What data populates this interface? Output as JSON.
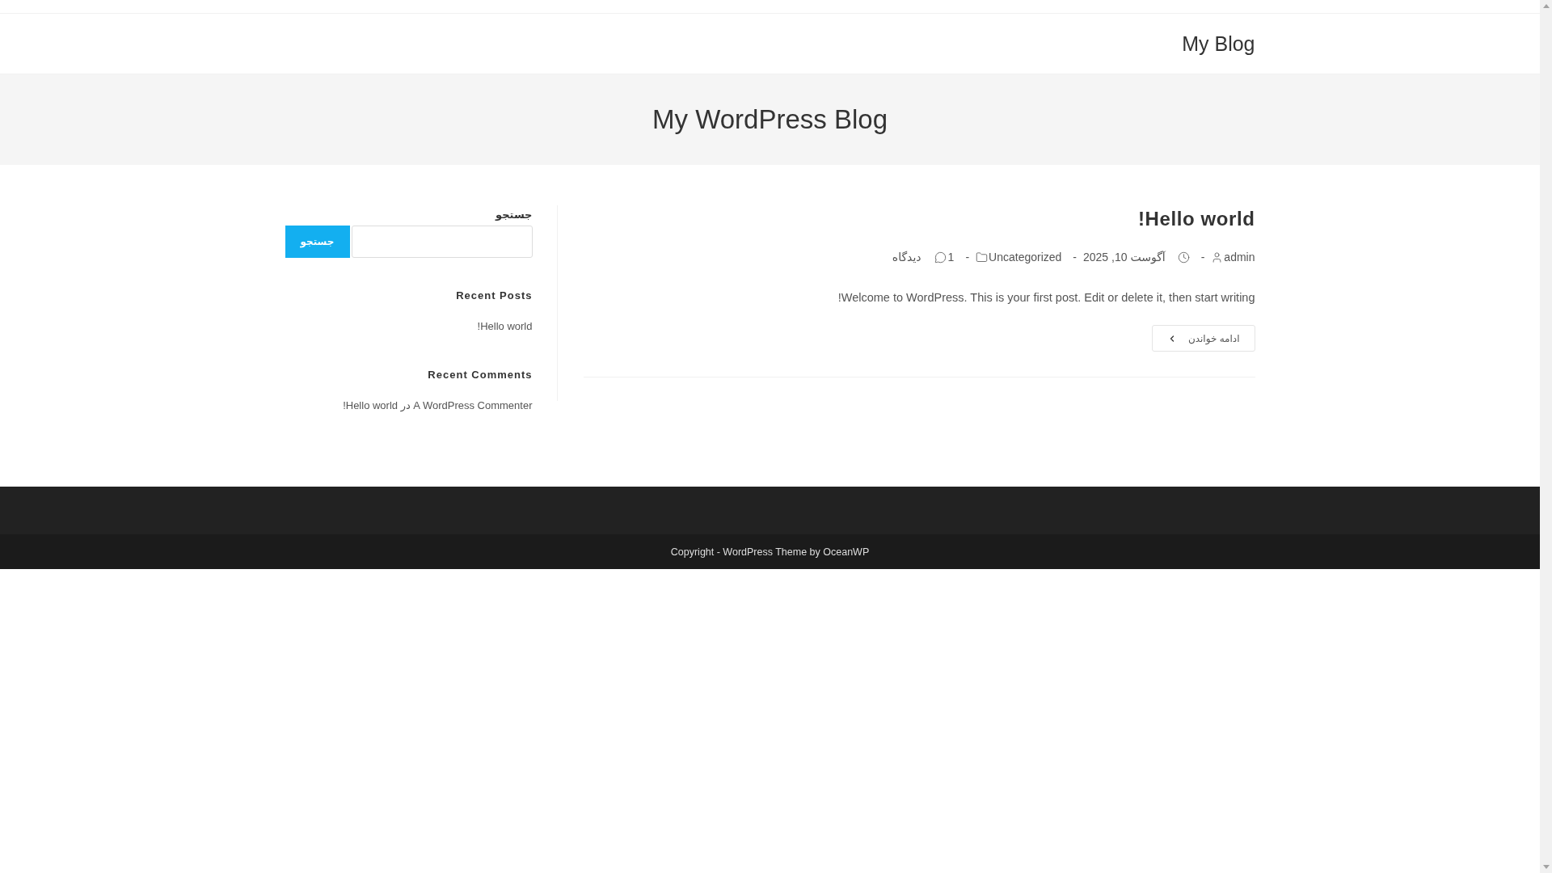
{
  "header": {
    "site_title": "My Blog"
  },
  "page_header": {
    "title": "My WordPress Blog"
  },
  "post": {
    "title": "Hello world!",
    "meta": [
      {
        "kind": "author",
        "text": "admin"
      },
      {
        "kind": "separator",
        "text": "-"
      },
      {
        "kind": "date",
        "text": "آگوست 10, 2025"
      },
      {
        "kind": "separator",
        "text": "-"
      },
      {
        "kind": "category",
        "text": "Uncategorized"
      },
      {
        "kind": "separator",
        "text": "-"
      },
      {
        "kind": "comments",
        "count": "1",
        "label": "دیدگاه"
      }
    ],
    "excerpt": "Welcome to WordPress. This is your first post. Edit or delete it, then start writing!",
    "read_more": "ادامه خواندن"
  },
  "sidebar": {
    "search": {
      "label": "جستجو",
      "button": "جستجو"
    },
    "widgets": [
      {
        "title": "Recent Posts",
        "items": [
          "Hello world!"
        ]
      },
      {
        "title": "Recent Comments",
        "items": [
          "A WordPress Commenter در Hello world!"
        ]
      }
    ]
  },
  "footer": {
    "copyright": "Copyright - WordPress Theme by OceanWP"
  }
}
